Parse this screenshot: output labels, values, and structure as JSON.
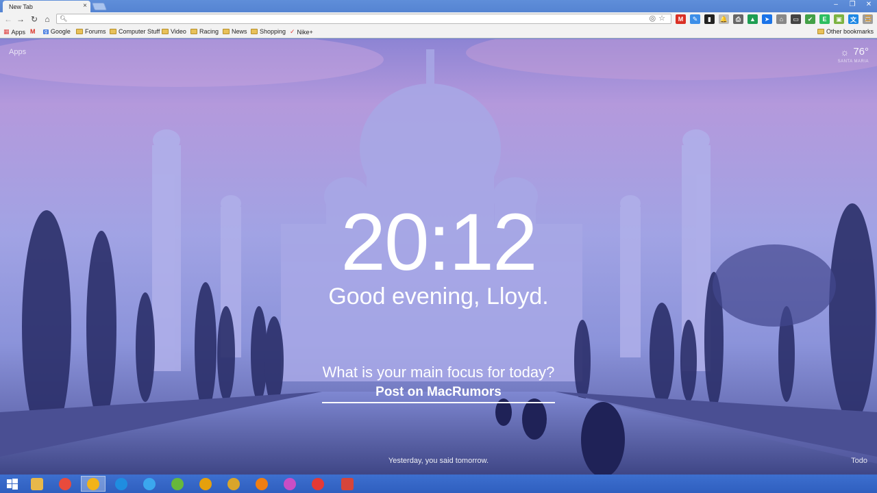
{
  "browser": {
    "tab_title": "New Tab",
    "tab_close": "×",
    "window_controls": {
      "minimize": "–",
      "restore": "❐",
      "close": "✕"
    }
  },
  "toolbar": {
    "omnibox_value": "",
    "extensions": [
      {
        "name": "gmail-extension-icon",
        "color": "#d93025",
        "glyph": "M"
      },
      {
        "name": "pencil-extension-icon",
        "color": "#3c8ee8",
        "glyph": "✎"
      },
      {
        "name": "phone-extension-icon",
        "color": "#222222",
        "glyph": "▮"
      },
      {
        "name": "bell-extension-icon",
        "color": "#bdbdbd",
        "glyph": "🔔"
      },
      {
        "name": "printer-extension-icon",
        "color": "#666666",
        "glyph": "⎙"
      },
      {
        "name": "drive-extension-icon",
        "color": "#1e9e53",
        "glyph": "▲"
      },
      {
        "name": "arrow-extension-icon",
        "color": "#1a73e8",
        "glyph": "➤"
      },
      {
        "name": "hat-extension-icon",
        "color": "#888888",
        "glyph": "⌂"
      },
      {
        "name": "cast-extension-icon",
        "color": "#444444",
        "glyph": "▭"
      },
      {
        "name": "check-extension-icon",
        "color": "#43a047",
        "glyph": "✔"
      },
      {
        "name": "evernote-extension-icon",
        "color": "#2dbe60",
        "glyph": "E"
      },
      {
        "name": "keep-extension-icon",
        "color": "#7cb342",
        "glyph": "▣"
      },
      {
        "name": "translate-extension-icon",
        "color": "#1e88e5",
        "glyph": "文"
      },
      {
        "name": "screen-extension-icon",
        "color": "#9e9e9e",
        "glyph": "▢"
      }
    ]
  },
  "bookmarks": {
    "items": [
      {
        "label": "Apps",
        "kind": "apps"
      },
      {
        "label": "",
        "kind": "gmail"
      },
      {
        "label": "Google",
        "kind": "google"
      },
      {
        "label": "Forums",
        "kind": "folder"
      },
      {
        "label": "Computer Stuff",
        "kind": "folder"
      },
      {
        "label": "Video",
        "kind": "folder"
      },
      {
        "label": "Racing",
        "kind": "folder"
      },
      {
        "label": "News",
        "kind": "folder"
      },
      {
        "label": "Shopping",
        "kind": "folder"
      },
      {
        "label": "Nike+",
        "kind": "nike"
      }
    ],
    "other": "Other bookmarks"
  },
  "momentum": {
    "apps_link": "Apps",
    "weather": {
      "temperature": "76°",
      "location": "SANTA MARIA"
    },
    "clock": "20:12",
    "greeting": "Good evening, Lloyd.",
    "focus_question": "What is your main focus for today?",
    "focus_answer": "Post on MacRumors",
    "quote": "Yesterday, you said tomorrow.",
    "todo": "Todo"
  },
  "taskbar": {
    "items": [
      {
        "name": "start-button",
        "color": "#ffffff"
      },
      {
        "name": "file-explorer-icon",
        "color": "#e8b84a"
      },
      {
        "name": "chrome-icon",
        "color": "#e84b3c"
      },
      {
        "name": "app-icon",
        "color": "#f2b318"
      },
      {
        "name": "internet-explorer-icon",
        "color": "#1f8de0"
      },
      {
        "name": "itunes-icon",
        "color": "#3ba7ee"
      },
      {
        "name": "utorrent-icon",
        "color": "#67b83c"
      },
      {
        "name": "plex-icon",
        "color": "#e5a00d"
      },
      {
        "name": "pineapple-icon",
        "color": "#d9a52a"
      },
      {
        "name": "vlc-icon",
        "color": "#f07e12"
      },
      {
        "name": "picasa-icon",
        "color": "#c94ec5"
      },
      {
        "name": "app-red-icon",
        "color": "#e53935"
      },
      {
        "name": "window-app-icon",
        "color": "#d6453a"
      }
    ]
  }
}
